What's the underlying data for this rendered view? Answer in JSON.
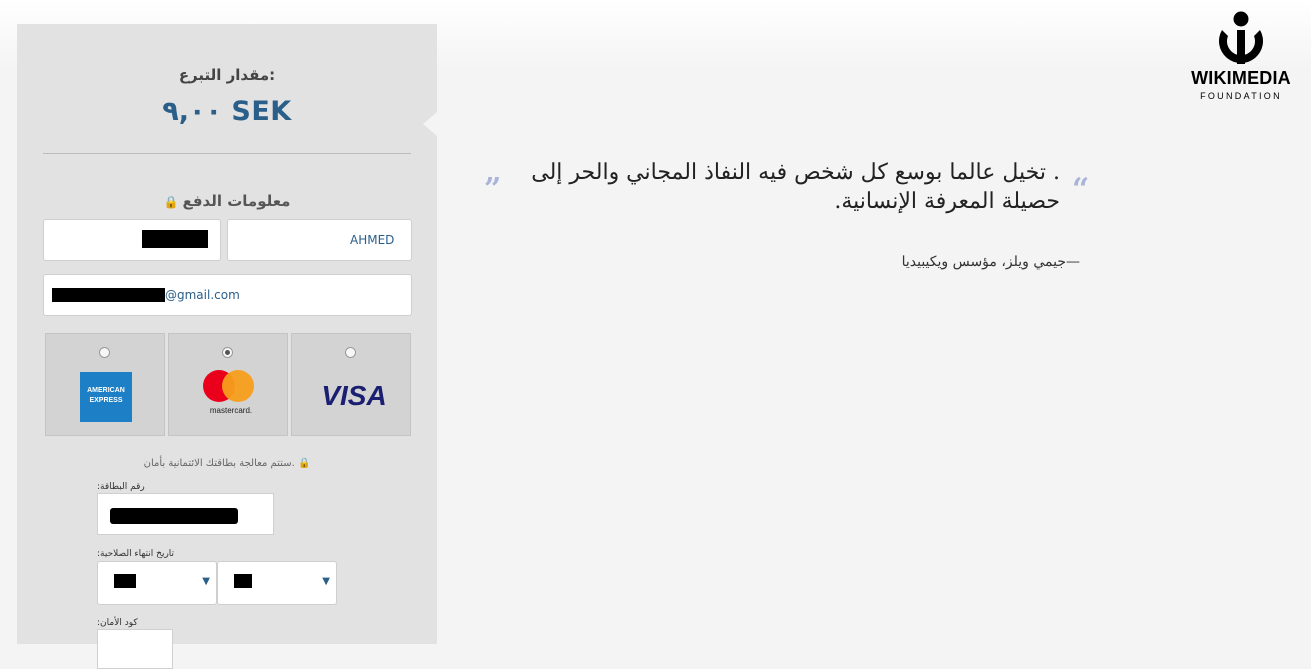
{
  "donation": {
    "amount_label": "مقدار التبرع:",
    "amount_value": "٩,٠٠ SEK",
    "payment_info_label": "معلومات الدفع",
    "first_name": "AHMED",
    "email_suffix": "@gmail.com",
    "secure_note": "ستتم معالجة بطاقتك الائتمانية بأمان.",
    "card_number_label": ":رقم البطاقة",
    "expiry_label": ":تاريخ انتهاء الصلاحية",
    "security_code_label": ":كود الأمان"
  },
  "cards": {
    "amex_line1": "AMERICAN",
    "amex_line2": "EXPRESS",
    "mastercard_caption": "mastercard.",
    "visa": "VISA",
    "selected": "mastercard"
  },
  "quote": {
    "text": ". تخيل عالما بوسع كل شخص فيه النفاذ المجاني والحر إلى حصيلة المعرفة الإنسانية.",
    "attribution": "—جيمي ويلز، مؤسس ويكيبيديا",
    "open_mark": "”",
    "close_mark": "“"
  },
  "logo": {
    "title": "WIKIMEDIA",
    "subtitle": "FOUNDATION"
  },
  "colors": {
    "accent": "#2a5f8a",
    "panel": "#e2e2e2"
  }
}
